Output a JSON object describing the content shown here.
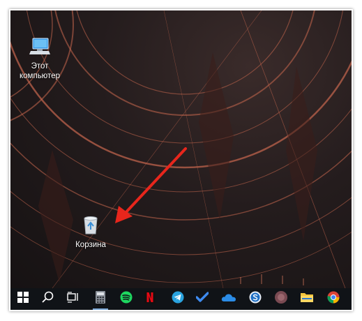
{
  "desktop": {
    "icons": [
      {
        "label": "Этот компьютер",
        "icon": "this-pc-icon"
      },
      {
        "label": "Корзина",
        "icon": "recycle-bin-icon"
      }
    ]
  },
  "taskbar": {
    "items": [
      {
        "icon": "windows-start-icon"
      },
      {
        "icon": "search-icon"
      },
      {
        "icon": "task-view-icon"
      },
      {
        "icon": "calculator-icon"
      },
      {
        "icon": "spotify-icon"
      },
      {
        "icon": "netflix-icon"
      },
      {
        "icon": "telegram-icon"
      },
      {
        "icon": "todo-icon"
      },
      {
        "icon": "onedrive-icon"
      },
      {
        "icon": "skype-icon"
      },
      {
        "icon": "app-blurred-icon"
      },
      {
        "icon": "file-explorer-icon"
      },
      {
        "icon": "chrome-icon"
      }
    ]
  },
  "colors": {
    "accent_arrow": "#e8261c",
    "taskbar": "#101317",
    "wallpaper_lines": "#c8674e"
  }
}
